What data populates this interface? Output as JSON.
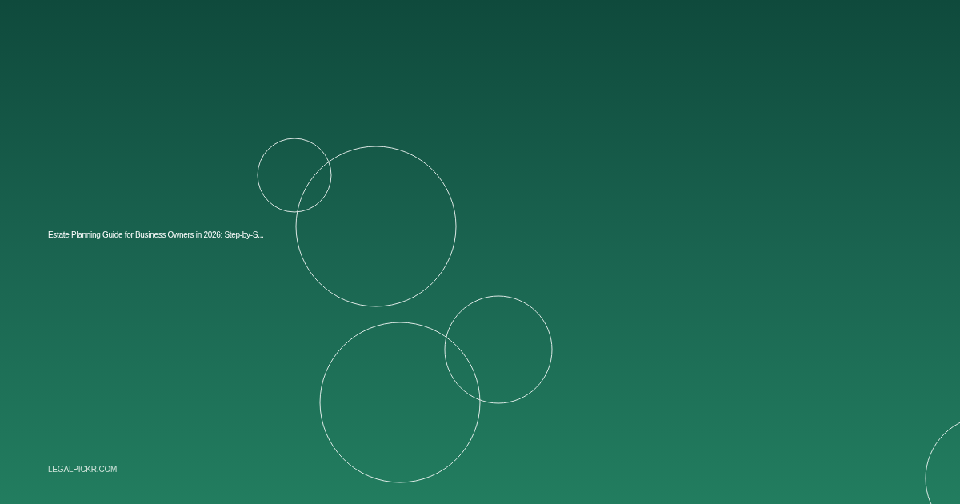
{
  "title": "Estate Planning Guide for Business Owners in 2026: Step-by-S...",
  "site": "LEGALPICKR.COM"
}
